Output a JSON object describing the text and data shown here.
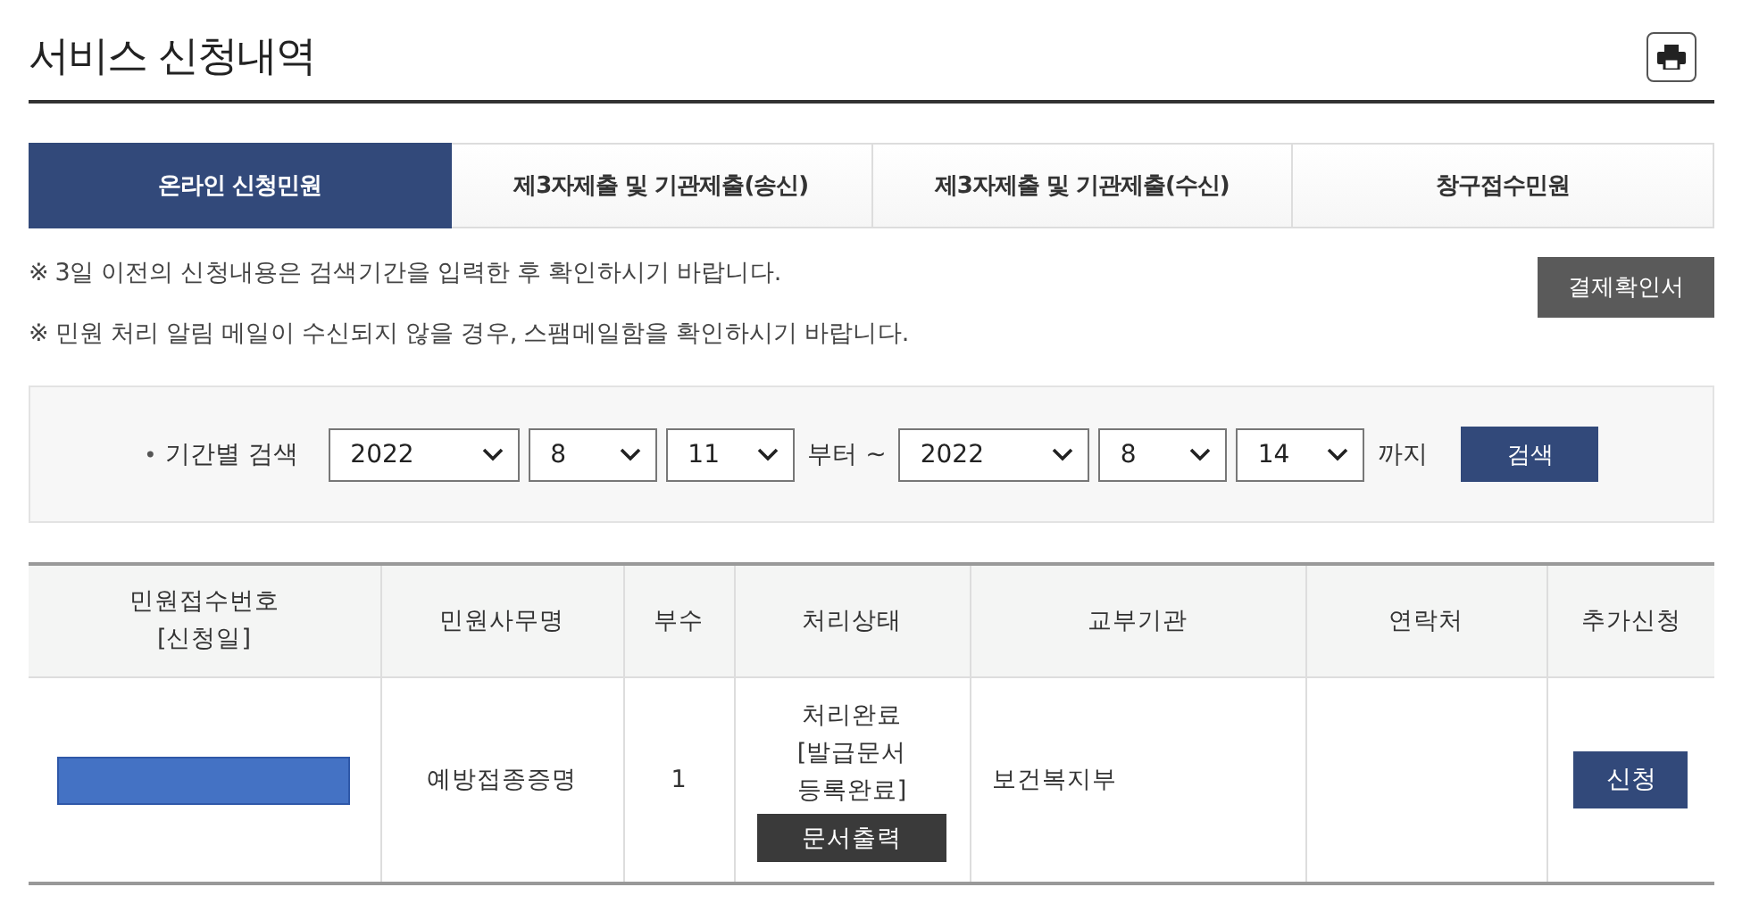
{
  "title": "서비스 신청내역",
  "tabs": [
    {
      "label": "온라인 신청민원",
      "selected": true
    },
    {
      "label": "제3자제출 및 기관제출(송신)",
      "selected": false
    },
    {
      "label": "제3자제출 및 기관제출(수신)",
      "selected": false
    },
    {
      "label": "창구접수민원",
      "selected": false
    }
  ],
  "notices": [
    "※ 3일 이전의 신청내용은 검색기간을 입력한 후 확인하시기 바랍니다.",
    "※ 민원 처리 알림 메일이 수신되지 않을 경우, 스팸메일함을 확인하시기 바랍니다."
  ],
  "payment_button": "결제확인서",
  "search": {
    "bullet": "•",
    "label": "기간별 검색",
    "from": [
      "2022",
      "8",
      "11"
    ],
    "from_suffix": "부터 ~",
    "to": [
      "2022",
      "8",
      "14"
    ],
    "to_suffix": "까지",
    "button": "검색"
  },
  "table": {
    "columns": [
      [
        "민원접수번호",
        "[신청일]"
      ],
      [
        "민원사무명"
      ],
      [
        "부수"
      ],
      [
        "처리상태"
      ],
      [
        "교부기관"
      ],
      [
        "연락처"
      ],
      [
        "추가신청"
      ]
    ],
    "rows": [
      {
        "redacted": true,
        "name": "예방접종증명",
        "copies": "1",
        "status": [
          "처리완료",
          "[발급문서",
          "등록완료]"
        ],
        "print_button": "문서출력",
        "agency": "보건복지부",
        "apply_button": "신청"
      }
    ]
  }
}
